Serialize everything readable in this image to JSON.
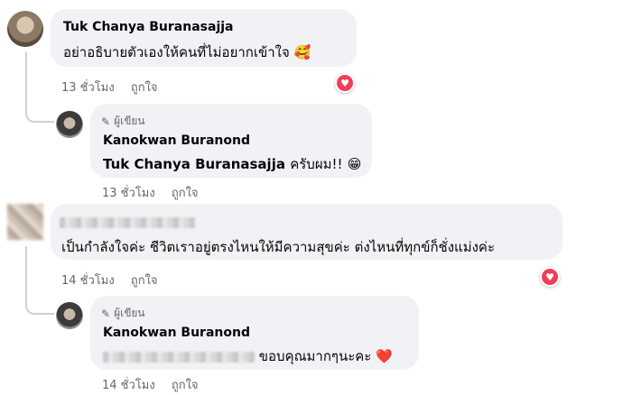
{
  "comments": [
    {
      "author": "Tuk Chanya Buranasajja",
      "text": "อย่าอธิบายตัวเองให้คนที่ไม่อยากเข้าใจ",
      "emoji": "🥰",
      "time": "13 ชั่วโมง",
      "like_label": "ถูกใจ",
      "reaction": "heart-icon"
    },
    {
      "author_tag": "ผู้เขียน",
      "author": "Kanokwan Buranond",
      "mention": "Tuk Chanya Buranasajja",
      "text": "ครับผม!!",
      "emoji": "😁",
      "time": "13 ชั่วโมง",
      "like_label": "ถูกใจ"
    },
    {
      "text": "เป็นกำลังใจค่ะ ชีวิตเราอยู่ตรงไหนให้มีความสุขค่ะ ต่งไหนที่ทุกข์ก็ชั่งแม่งค่ะ",
      "time": "14 ชั่วโมง",
      "like_label": "ถูกใจ",
      "reaction": "heart-icon"
    },
    {
      "author_tag": "ผู้เขียน",
      "author": "Kanokwan Buranond",
      "text": "ขอบคุณมากๆนะคะ",
      "emoji": "❤️",
      "time": "14 ชั่วโมง",
      "like_label": "ถูกใจ"
    }
  ],
  "colors": {
    "bubble": "#f0f2f5",
    "meta_text": "#65676b",
    "heart": "#f33e58",
    "thread_line": "#ced0d4"
  }
}
